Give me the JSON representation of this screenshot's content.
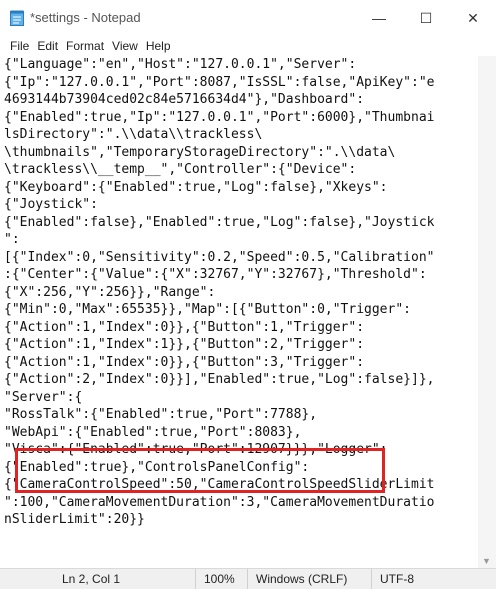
{
  "window": {
    "title": "*settings - Notepad",
    "icon": "notepad-icon",
    "buttons": {
      "minimize": "—",
      "maximize": "☐",
      "close": "✕"
    }
  },
  "menu": {
    "items": [
      "File",
      "Edit",
      "Format",
      "View",
      "Help"
    ]
  },
  "editor": {
    "lines": [
      "{\"Language\":\"en\",\"Host\":\"127.0.0.1\",\"Server\":",
      "{\"Ip\":\"127.0.0.1\",\"Port\":8087,\"IsSSL\":false,\"ApiKey\":\"e",
      "4693144b73904ced02c84e5716634d4\"},\"Dashboard\":",
      "{\"Enabled\":true,\"Ip\":\"127.0.0.1\",\"Port\":6000},\"Thumbnai",
      "lsDirectory\":\".\\\\data\\\\trackless\\",
      "\\thumbnails\",\"TemporaryStorageDirectory\":\".\\\\data\\",
      "\\trackless\\\\__temp__\",\"Controller\":{\"Device\":",
      "{\"Keyboard\":{\"Enabled\":true,\"Log\":false},\"Xkeys\":",
      "{\"Joystick\":",
      "{\"Enabled\":false},\"Enabled\":true,\"Log\":false},\"Joystick",
      "\":",
      "[{\"Index\":0,\"Sensitivity\":0.2,\"Speed\":0.5,\"Calibration\"",
      ":{\"Center\":{\"Value\":{\"X\":32767,\"Y\":32767},\"Threshold\":",
      "{\"X\":256,\"Y\":256}},\"Range\":",
      "{\"Min\":0,\"Max\":65535}},\"Map\":[{\"Button\":0,\"Trigger\":",
      "{\"Action\":1,\"Index\":0}},{\"Button\":1,\"Trigger\":",
      "{\"Action\":1,\"Index\":1}},{\"Button\":2,\"Trigger\":",
      "{\"Action\":1,\"Index\":0}},{\"Button\":3,\"Trigger\":",
      "{\"Action\":2,\"Index\":0}}],\"Enabled\":true,\"Log\":false}]},",
      "\"Server\":{",
      "\"RossTalk\":{\"Enabled\":true,\"Port\":7788},",
      "\"WebApi\":{\"Enabled\":true,\"Port\":8083},",
      "\"Visca\":{\"Enabled\":true,\"Port\":12907}}},\"Logger\":",
      "{\"Enabled\":true},\"ControlsPanelConfig\":",
      "{\"CameraControlSpeed\":50,\"CameraControlSpeedSliderLimit",
      "\":100,\"CameraMovementDuration\":3,\"CameraMovementDuratio",
      "nSliderLimit\":20}}"
    ]
  },
  "status": {
    "position": "Ln 2, Col 1",
    "zoom": "100%",
    "line_ending": "Windows (CRLF)",
    "encoding": "UTF-8"
  },
  "annotation": {
    "color": "#e02424"
  }
}
